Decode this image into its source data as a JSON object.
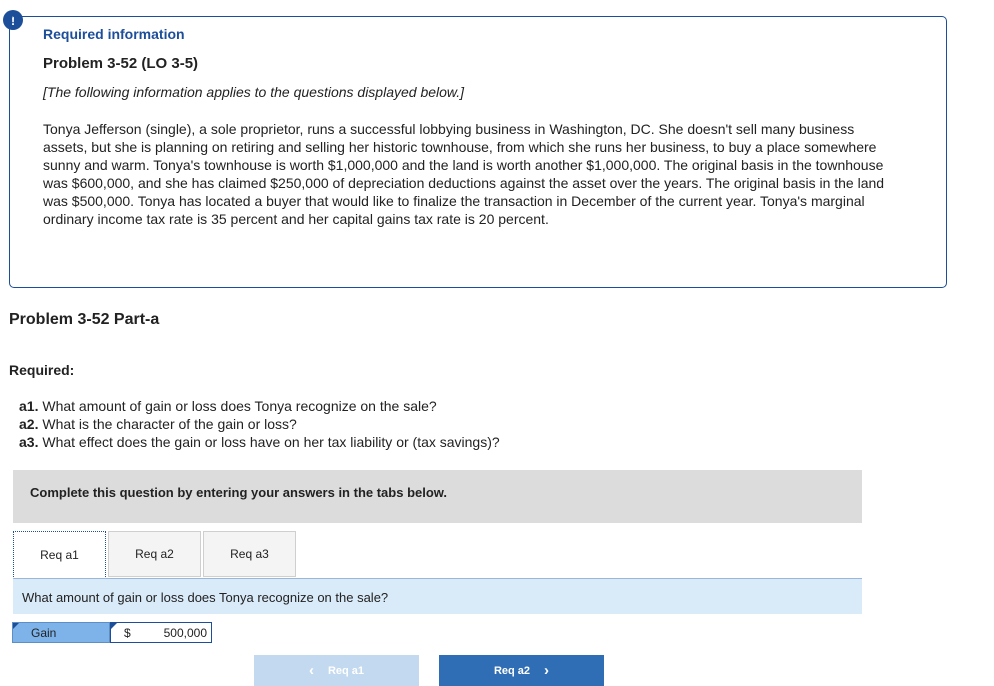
{
  "alert": {
    "icon": "exclamation-icon",
    "symbol": "!"
  },
  "info": {
    "title": "Required information",
    "problem": "Problem 3-52 (LO 3-5)",
    "note": "[The following information applies to the questions displayed below.]",
    "body": "Tonya Jefferson (single), a sole proprietor, runs a successful lobbying business in Washington, DC. She doesn't sell many business assets, but she is planning on retiring and selling her historic townhouse, from which she runs her business, to buy a place somewhere sunny and warm. Tonya's townhouse is worth $1,000,000 and the land is worth another $1,000,000. The original basis in the townhouse was $600,000, and she has claimed $250,000 of depreciation deductions against the asset over the years. The original basis in the land was $500,000. Tonya has located a buyer that would like to finalize the transaction in December of the current year. Tonya's marginal ordinary income tax rate is 35 percent and her capital gains tax rate is 20 percent."
  },
  "part_title": "Problem 3-52 Part-a",
  "required_label": "Required:",
  "questions": [
    {
      "label": "a1.",
      "text": "What amount of gain or loss does Tonya recognize on the sale?"
    },
    {
      "label": "a2.",
      "text": "What is the character of the gain or loss?"
    },
    {
      "label": "a3.",
      "text": "What effect does the gain or loss have on her tax liability or (tax savings)?"
    }
  ],
  "instruction": "Complete this question by entering your answers in the tabs below.",
  "tabs": [
    {
      "label": "Req a1",
      "active": true
    },
    {
      "label": "Req a2",
      "active": false
    },
    {
      "label": "Req a3",
      "active": false
    }
  ],
  "current_question": "What amount of gain or loss does Tonya recognize on the sale?",
  "answer": {
    "type_value": "Gain",
    "currency": "$",
    "amount": "500,000"
  },
  "nav": {
    "prev_label": "Req a1",
    "next_label": "Req a2",
    "prev_icon": "chevron-left-icon",
    "next_icon": "chevron-right-icon"
  },
  "colors": {
    "accent": "#1c4e9a",
    "tab_panel": "#d9eaf8",
    "instruction_bg": "#dcdcdc",
    "next_button": "#2f6eb5",
    "prev_button_disabled": "#c3d9ef"
  }
}
